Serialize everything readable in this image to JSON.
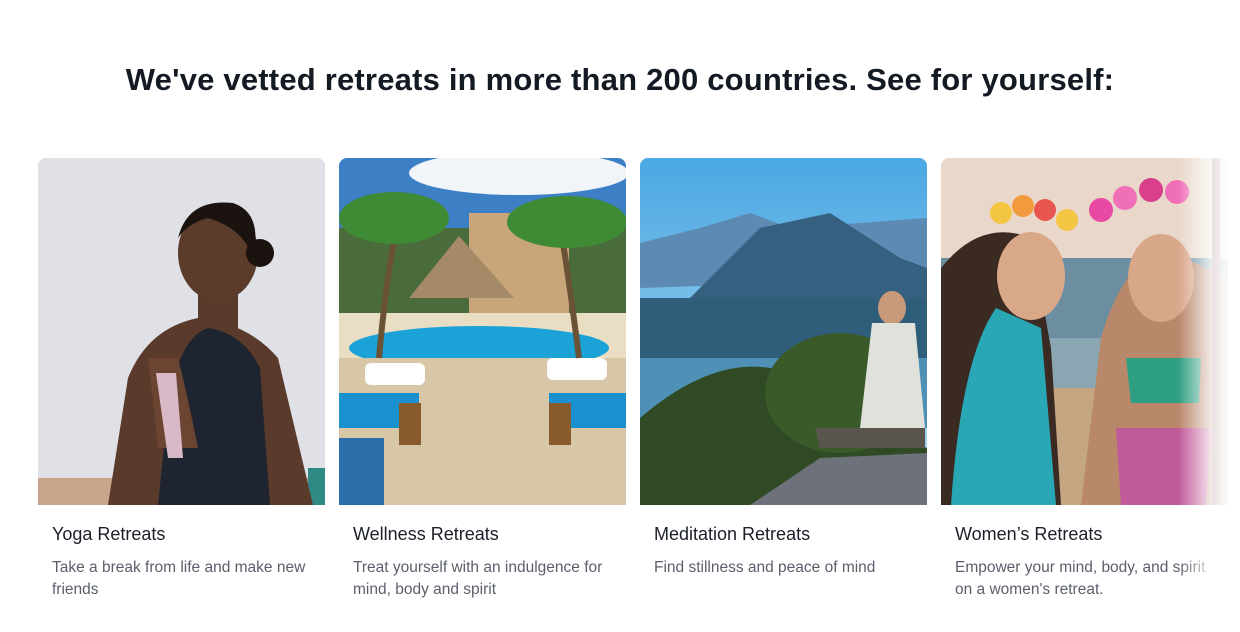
{
  "heading": "We've vetted retreats in more than 200 countries. See for yourself:",
  "cards": [
    {
      "title": "Yoga Retreats",
      "description": "Take a break from life and make new friends"
    },
    {
      "title": "Wellness Retreats",
      "description": "Treat yourself with an indulgence for mind, body and spirit"
    },
    {
      "title": "Meditation Retreats",
      "description": "Find stillness and peace of mind"
    },
    {
      "title": "Women’s Retreats",
      "description": "Empower your mind, body, and spirit on a women's retreat."
    }
  ]
}
